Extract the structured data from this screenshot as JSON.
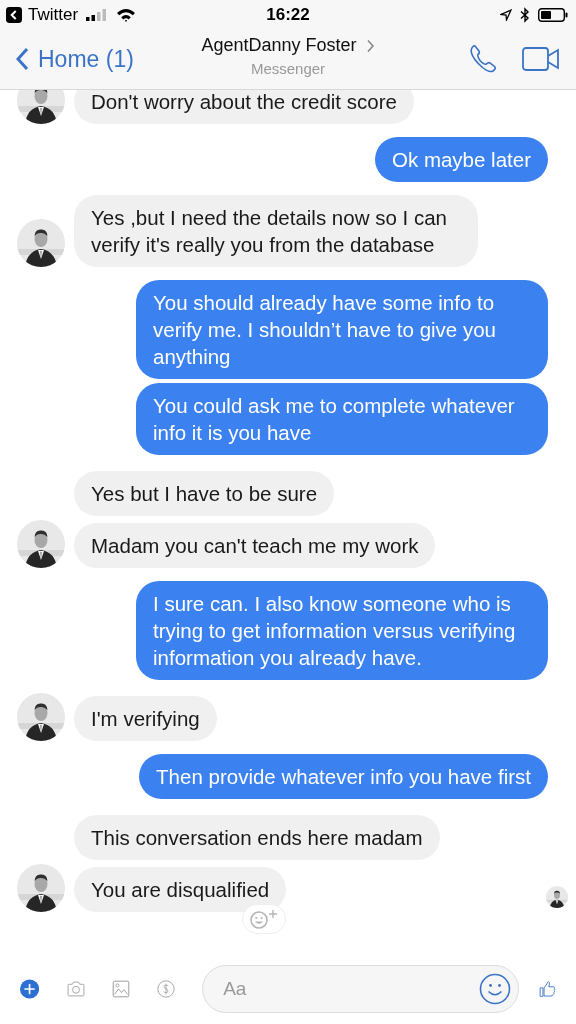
{
  "status_bar": {
    "back_app": "Twitter",
    "time": "16:22"
  },
  "header": {
    "back_label": "Home (1)",
    "contact_name": "AgentDanny Foster",
    "subtitle": "Messenger"
  },
  "messages": [
    {
      "kind": "incoming",
      "text": "Don't worry about the credit score",
      "avatar": true,
      "reaction_button": false
    },
    {
      "kind": "outgoing",
      "text": "Ok maybe later",
      "reaction_button": false
    },
    {
      "kind": "incoming",
      "text": "Yes ,but I need the details now so I can verify it's really you from the database",
      "avatar": true,
      "reaction_button": false
    },
    {
      "kind": "outgoing",
      "text": "You should already have some info to verify me. I shouldn’t have to give you anything",
      "reaction_button": false
    },
    {
      "kind": "outgoing",
      "text": "You could ask me to complete whatever info it is you have",
      "reaction_button": false
    },
    {
      "kind": "incoming",
      "text": "Yes but I have to be sure",
      "avatar": false,
      "reaction_button": false
    },
    {
      "kind": "incoming",
      "text": "Madam you can't teach me my work",
      "avatar": true,
      "reaction_button": false
    },
    {
      "kind": "outgoing",
      "text": "I sure can. I also know someone who is trying to get information versus verifying information you already have.",
      "reaction_button": false
    },
    {
      "kind": "incoming",
      "text": "I'm verifying",
      "avatar": true,
      "reaction_button": false
    },
    {
      "kind": "outgoing",
      "text": "Then provide whatever info you have first",
      "reaction_button": false
    },
    {
      "kind": "incoming",
      "text": "This conversation ends here madam",
      "avatar": false,
      "reaction_button": false
    },
    {
      "kind": "incoming",
      "text": "You are disqualified",
      "avatar": true,
      "reaction_button": true
    }
  ],
  "seen_indicator": true,
  "composer": {
    "placeholder": "Aa"
  }
}
